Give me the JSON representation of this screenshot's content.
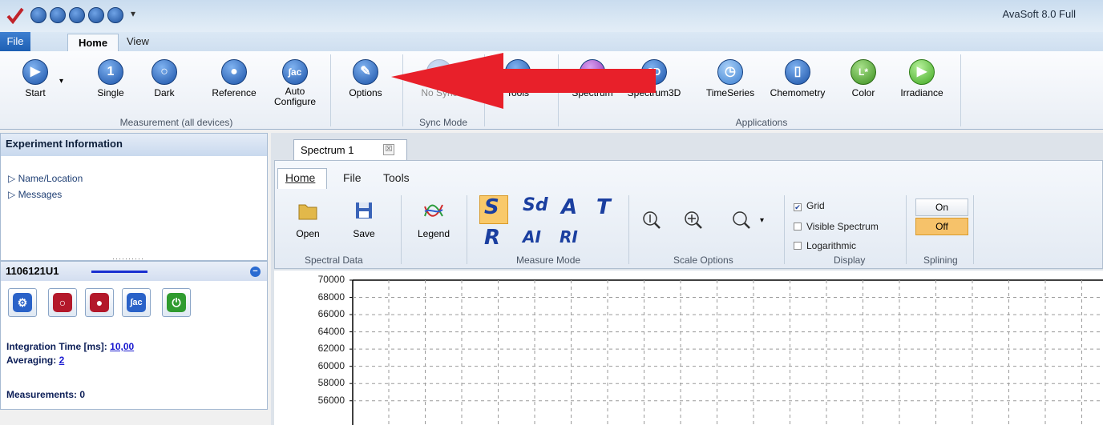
{
  "window": {
    "title": "AvaSoft 8.0 Full"
  },
  "qat": {
    "icons": [
      "check-logo-icon",
      "settings-round-icon",
      "start-round-icon",
      "options-round-icon",
      "lamp-round-icon",
      "auto-configure-round-icon",
      "customize-dropdown-icon"
    ]
  },
  "tabs": {
    "file": "File",
    "home": "Home",
    "view": "View"
  },
  "ribbon": {
    "measurement": {
      "start": "Start",
      "single": "Single",
      "dark": "Dark",
      "reference": "Reference",
      "auto_configure_1": "Auto",
      "auto_configure_2": "Configure",
      "group": "Measurement (all devices)"
    },
    "options": "Options",
    "sync": {
      "no_sync": "No Sync",
      "group": "Sync Mode"
    },
    "tools": "Tools",
    "applications": {
      "spectrum": "Spectrum",
      "spectrum3d": "Spectrum3D",
      "timeseries": "TimeSeries",
      "chemometry": "Chemometry",
      "color": "Color",
      "irradiance": "Irradiance",
      "group": "Applications"
    },
    "icon_text": {
      "single": "1",
      "auto": "∫ac",
      "spectrum3d": "3D",
      "color": "L*"
    }
  },
  "experiment": {
    "title": "Experiment Information",
    "items": [
      "▷ Name/Location",
      "▷ Messages"
    ],
    "grip": "··········"
  },
  "device": {
    "id": "1106121U1",
    "collapse": "−",
    "integration_label": "Integration Time  [ms]:",
    "integration_value": "10,00",
    "averaging_label": "Averaging:",
    "averaging_value": "2",
    "measurements_label": "Measurements:",
    "measurements_value": "0",
    "button_auto": "∫ac"
  },
  "spectrum_tab": {
    "label": "Spectrum 1",
    "close": "☒"
  },
  "inner": {
    "tabs": {
      "home": "Home",
      "file": "File",
      "tools": "Tools"
    },
    "spectral": {
      "open": "Open",
      "save": "Save",
      "group": "Spectral Data"
    },
    "legend": "Legend",
    "measure_mode": {
      "s": "S",
      "sd": "Sd",
      "a": "A",
      "t": "T",
      "r": "R",
      "ai": "AI",
      "ri": "RI",
      "group": "Measure Mode"
    },
    "scale": {
      "group": "Scale Options"
    },
    "display": {
      "grid": "Grid",
      "visible": "Visible Spectrum",
      "log": "Logarithmic",
      "group": "Display",
      "grid_checked": "✔"
    },
    "splining": {
      "on": "On",
      "off": "Off",
      "group": "Splining"
    }
  },
  "chart_data": {
    "type": "line",
    "y_ticks": [
      "70000",
      "68000",
      "66000",
      "64000",
      "62000",
      "60000",
      "58000",
      "56000"
    ],
    "ylim": [
      56000,
      70000
    ],
    "grid": true,
    "series": []
  },
  "colors": {
    "accent": "#1d5fb3",
    "arrow": "#e8202a",
    "splining_off": "#f6c26a"
  }
}
